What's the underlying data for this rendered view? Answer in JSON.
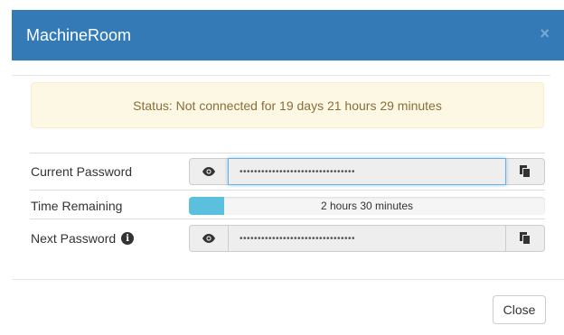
{
  "dialog": {
    "title": "MachineRoom",
    "close_glyph": "×"
  },
  "status": {
    "text": "Status: Not connected for 19 days 21 hours 29 minutes"
  },
  "rows": {
    "current_password": {
      "label": "Current Password",
      "value": "••••••••••••••••••••••••••••••••",
      "reveal_icon": "eye-icon",
      "copy_icon": "copy-icon"
    },
    "time_remaining": {
      "label": "Time Remaining",
      "text": "2 hours 30 minutes",
      "progress_percent": 10
    },
    "next_password": {
      "label": "Next Password",
      "info_icon": "info-icon",
      "value": "••••••••••••••••••••••••••••••••",
      "reveal_icon": "eye-icon",
      "copy_icon": "copy-icon"
    }
  },
  "footer": {
    "close_label": "Close"
  },
  "colors": {
    "header": "#337ab7",
    "alert_bg": "#fcf8e3",
    "alert_text": "#8a6d3b",
    "progress": "#5bc0de"
  }
}
